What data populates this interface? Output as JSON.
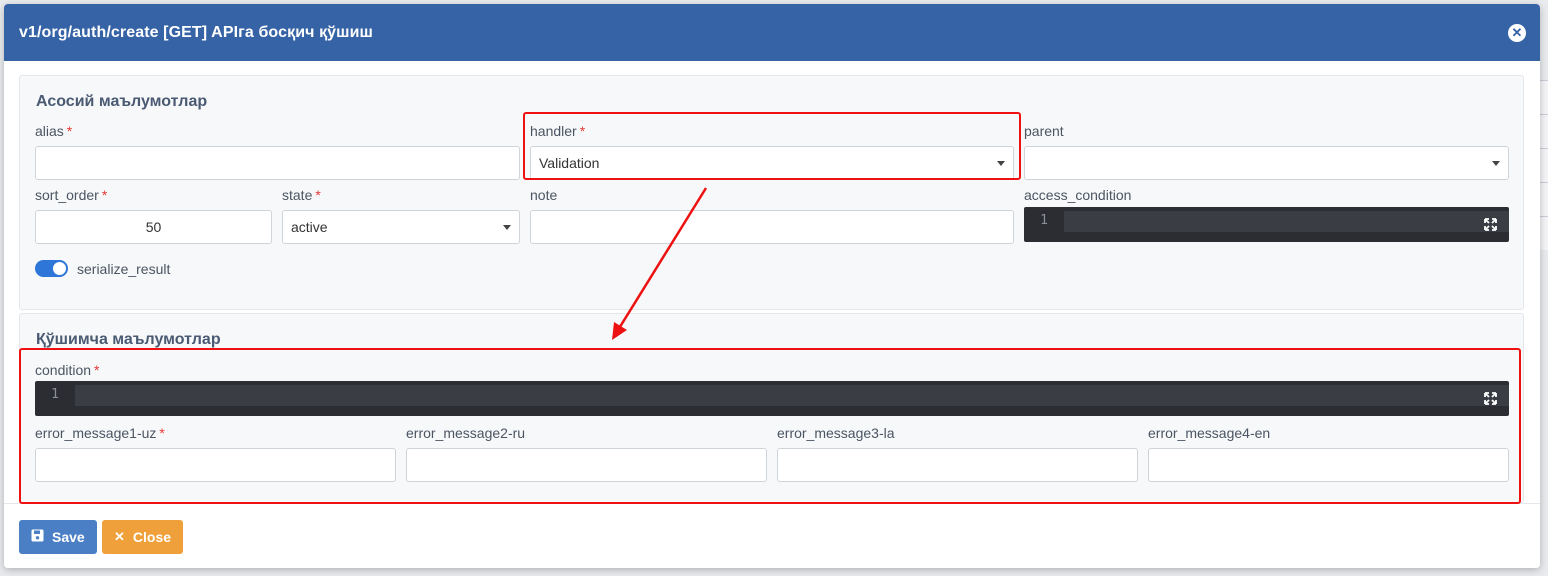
{
  "modal": {
    "title": "v1/org/auth/create [GET] APIга босқич қўшиш",
    "close_icon": "close-icon"
  },
  "main_section": {
    "title": "Асосий маълумотлар",
    "alias": {
      "label": "alias",
      "value": ""
    },
    "handler": {
      "label": "handler",
      "value": "Validation"
    },
    "parent": {
      "label": "parent",
      "value": ""
    },
    "sort_order": {
      "label": "sort_order",
      "value": "50"
    },
    "state": {
      "label": "state",
      "value": "active"
    },
    "note": {
      "label": "note",
      "value": ""
    },
    "access_condition": {
      "label": "access_condition",
      "line_number": "1"
    },
    "serialize_result": {
      "label": "serialize_result",
      "checked": true
    }
  },
  "extra_section": {
    "title": "Қўшимча маълумотлар",
    "condition": {
      "label": "condition",
      "line_number": "1"
    },
    "error_message1": {
      "label": "error_message1-uz",
      "value": ""
    },
    "error_message2": {
      "label": "error_message2-ru",
      "value": ""
    },
    "error_message3": {
      "label": "error_message3-la",
      "value": ""
    },
    "error_message4": {
      "label": "error_message4-en",
      "value": ""
    }
  },
  "footer": {
    "save_label": "Save",
    "close_label": "Close"
  },
  "required_mark": "*",
  "colors": {
    "header": "#3663a6",
    "save": "#4a7fc6",
    "close": "#f0a03a",
    "highlight": "#ee1111",
    "code_bg": "#2b2d33"
  }
}
